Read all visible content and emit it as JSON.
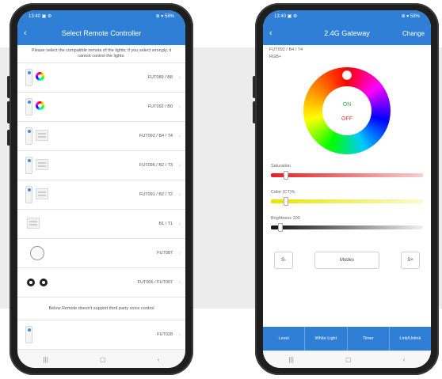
{
  "left_screen": {
    "status": {
      "time": "13:40 ▣ ⚙",
      "indicators": "⊕ ▾ 58%"
    },
    "header": {
      "back_label": "‹",
      "title": "Select Remote Controller"
    },
    "instruction": "Please select the compatible remote of the lights; if you select wrongly, it cannot control the lights.",
    "remotes": [
      {
        "model": "FUT089 / B8",
        "thumb": "wheel"
      },
      {
        "model": "FUT092 / B0",
        "thumb": "wheel"
      },
      {
        "model": "FUT092 / B4 / T4",
        "thumb": "panel"
      },
      {
        "model": "FUT096 / B2 / T3",
        "thumb": "panel"
      },
      {
        "model": "FUT091 / B2 / T2",
        "thumb": "panel"
      },
      {
        "model": "B1 / T1",
        "thumb": "panel"
      },
      {
        "model": "FUT087",
        "thumb": "knob"
      },
      {
        "model": "FUT006 / FUT007",
        "thumb": "dots"
      }
    ],
    "notice": "Below Remote doesn't support third party voice control",
    "extra_remote": {
      "model": "FUT028"
    },
    "chevron": "›",
    "navbar": {
      "recent": "|||",
      "home": "▢",
      "back": "‹"
    }
  },
  "right_screen": {
    "status": {
      "time": "13:40 ▣ ⚙",
      "indicators": "⊕ ▾ 58%"
    },
    "header": {
      "back_label": "‹",
      "title": "2.4G Gateway",
      "action": "Change"
    },
    "subtitle": "FUT092 / B4 / T4",
    "zone": "RGB+",
    "on_label": "ON",
    "off_label": "OFF",
    "saturation": {
      "label": "Saturation",
      "value": 0.1
    },
    "color_temp": {
      "label": "Color (CT)%",
      "value": 0.1
    },
    "brightness": {
      "label": "Brightness 100",
      "value": 0.06
    },
    "mode": {
      "minus": "S-",
      "label": "Modes",
      "plus": "S+"
    },
    "tabs": [
      "Level",
      "White Light",
      "Timer",
      "Link/Unlink"
    ],
    "navbar": {
      "recent": "|||",
      "home": "▢",
      "back": "‹"
    }
  },
  "colors": {
    "accent": "#2f7fd6",
    "on": "#2bb24c",
    "off": "#e53935"
  }
}
